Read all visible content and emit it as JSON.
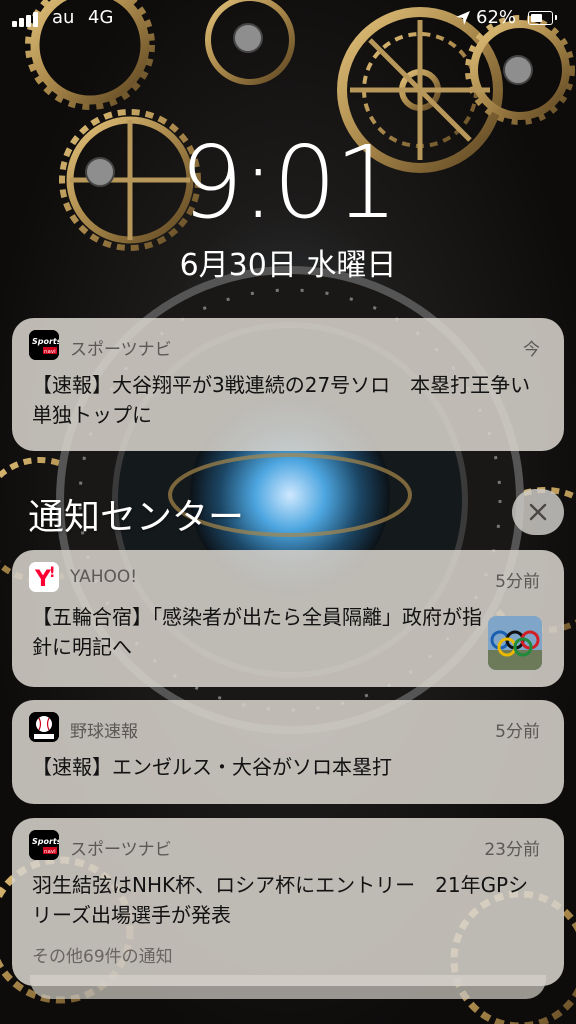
{
  "status_bar": {
    "carrier": "au",
    "network": "4G",
    "battery_percent_text": "62%",
    "battery_level": 0.62,
    "icons": [
      "signal-bars-icon",
      "location-arrow-icon",
      "battery-icon"
    ]
  },
  "lock": {
    "time": "9:01",
    "date": "6月30日 水曜日"
  },
  "top_notification": {
    "app": "スポーツナビ",
    "time": "今",
    "body": "【速報】大谷翔平が3戦連続の27号ソロ　本塁打王争い単独トップに",
    "icon": "sportsnavi-app-icon"
  },
  "notification_center": {
    "title": "通知センター",
    "close_icon": "close-x-icon",
    "notifications": [
      {
        "app": "YAHOO!",
        "time": "5分前",
        "body": "【五輪合宿】「感染者が出たら全員隔離」政府が指針に明記へ",
        "icon": "yahoo-app-icon",
        "has_thumbnail": true
      },
      {
        "app": "野球速報",
        "time": "5分前",
        "body": "【速報】エンゼルス・大谷がソロ本塁打",
        "icon": "baseball-app-icon"
      },
      {
        "app": "スポーツナビ",
        "time": "23分前",
        "body": "羽生結弦はNHK杯、ロシア杯にエントリー　21年GPシリーズ出場選手が発表",
        "more": "その他69件の通知",
        "icon": "sportsnavi-app-icon"
      }
    ]
  },
  "colors": {
    "card_bg": "#d6d2cb",
    "wallpaper_gold": "#a8874a",
    "yahoo_red": "#ff0033"
  }
}
